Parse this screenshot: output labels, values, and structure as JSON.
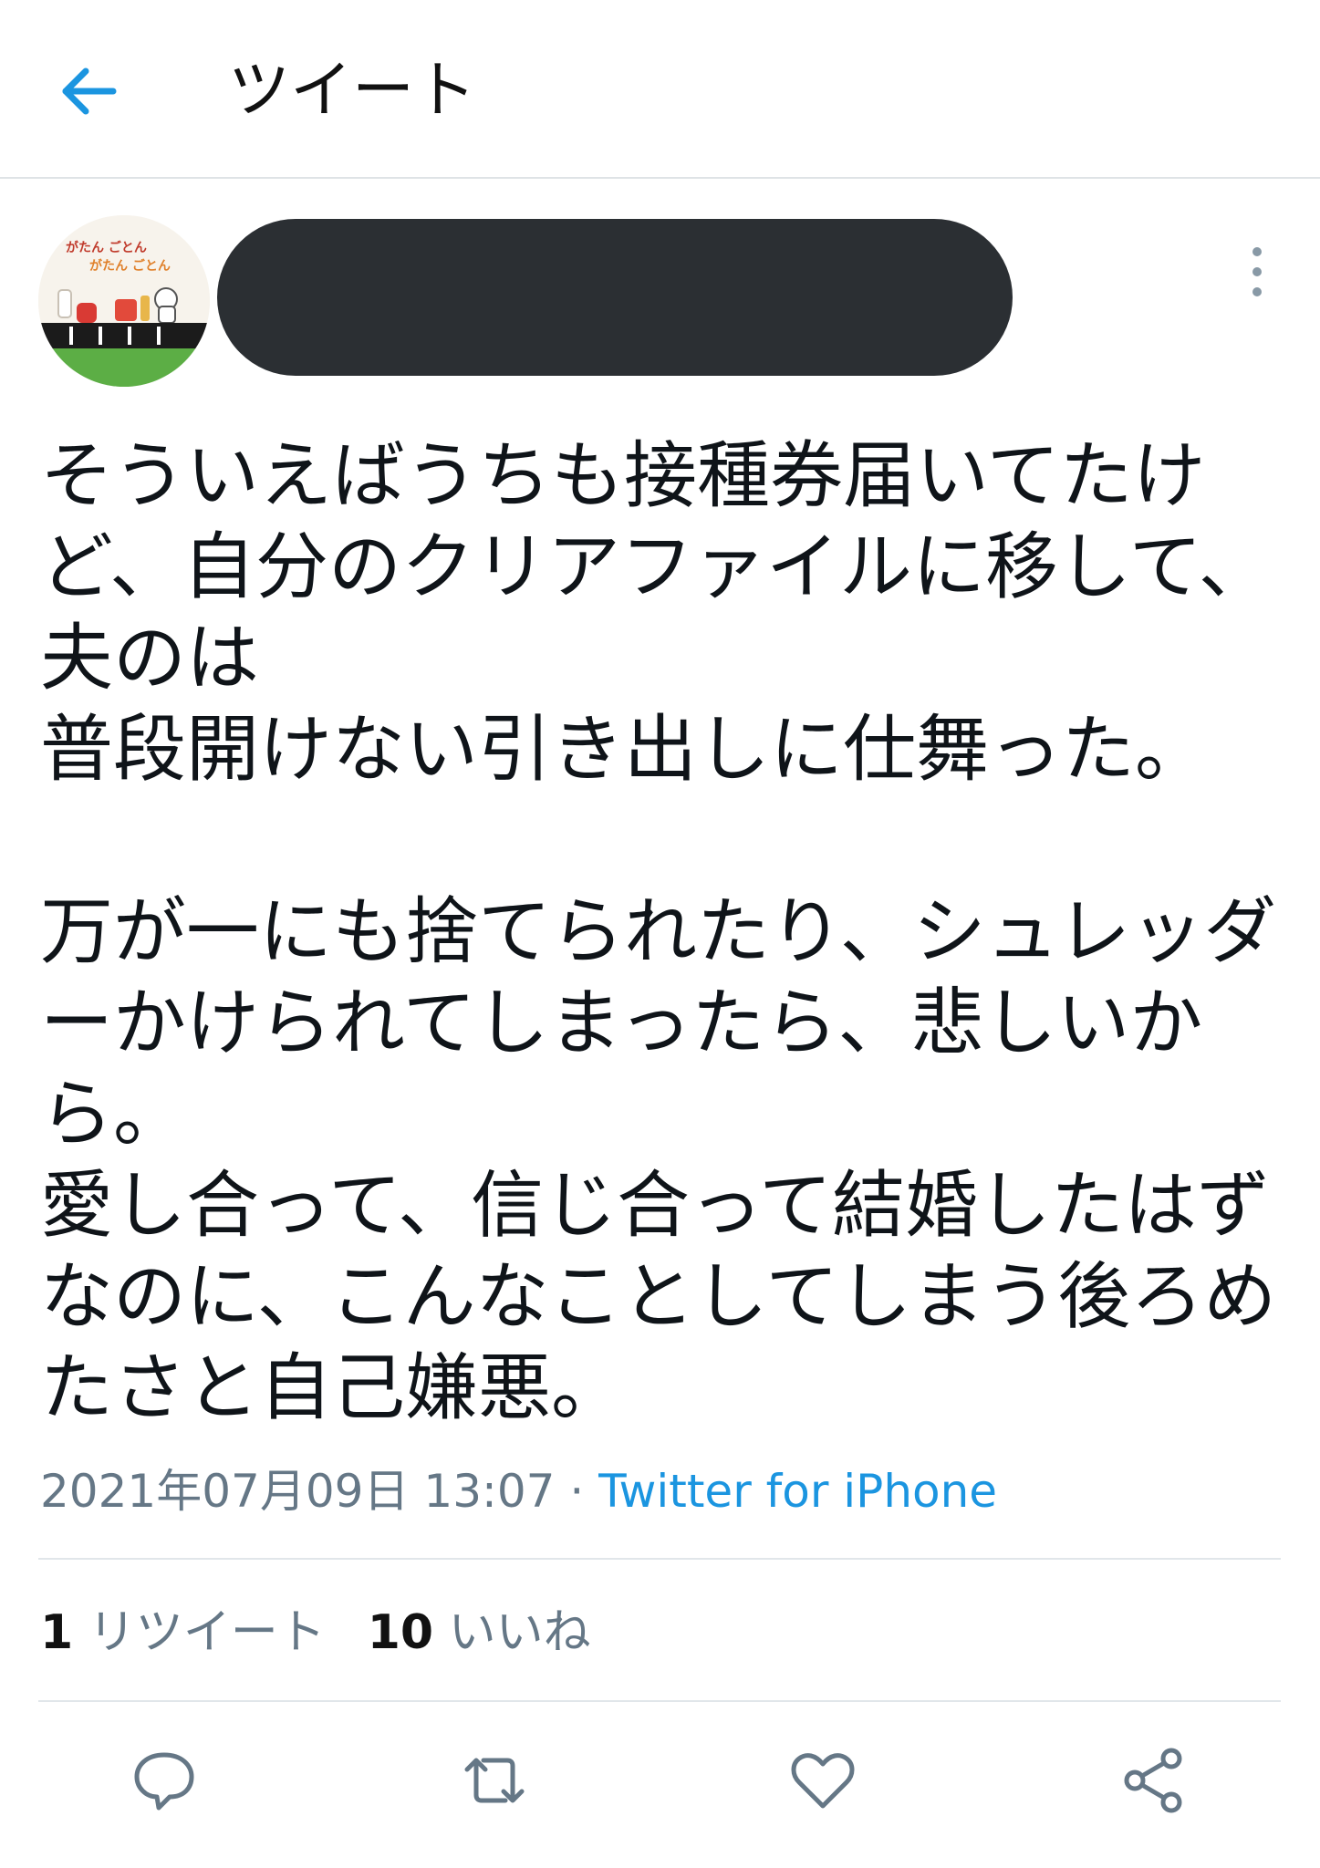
{
  "header": {
    "title": "ツイート"
  },
  "tweet": {
    "text": "そういえばうちも接種券届いてたけ\nど、自分のクリアファイルに移して、\n夫のは\n普段開けない引き出しに仕舞った。\n\n万が一にも捨てられたり、シュレッダ\nーかけられてしまったら、悲しいか\nら。\n愛し合って、信じ合って結婚したはず\nなのに、こんなことしてしまう後ろめ\nたさと自己嫌悪。",
    "timestamp": "2021年07月09日 13:07",
    "separator": " · ",
    "source": "Twitter for iPhone"
  },
  "stats": {
    "retweets_count": "1",
    "retweets_label": "リツイート",
    "likes_count": "10",
    "likes_label": "いいね"
  },
  "avatar_text": {
    "line1": "がたん ごとん",
    "line2": "がたん ごとん"
  },
  "icons": [
    "back-arrow-icon",
    "more-vertical-icon",
    "reply-icon",
    "retweet-icon",
    "like-icon",
    "share-icon"
  ],
  "colors": {
    "accent": "#1b95e0",
    "muted": "#657786",
    "redaction": "#2b2f33"
  }
}
